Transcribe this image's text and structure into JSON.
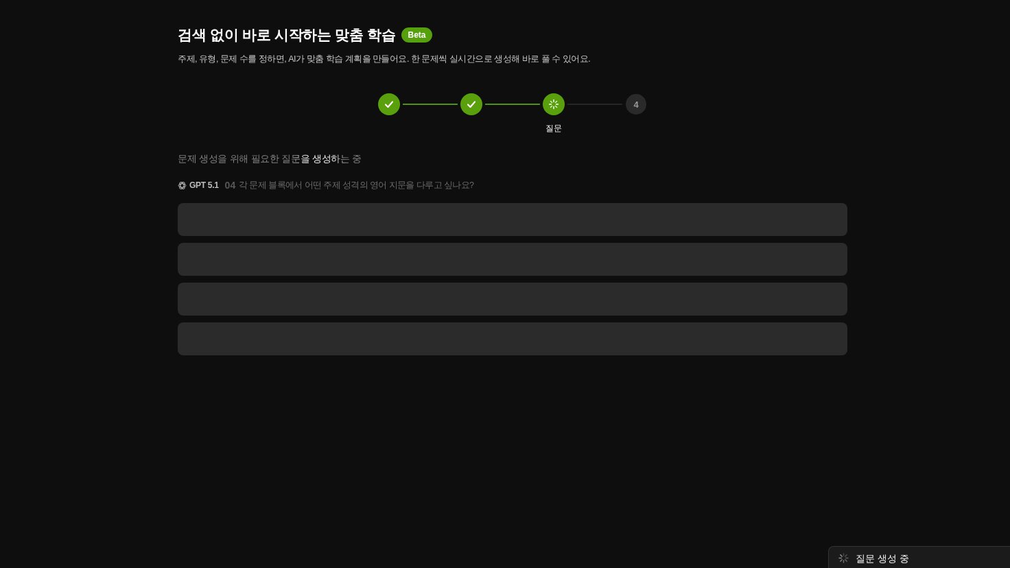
{
  "header": {
    "title": "검색 없이 바로 시작하는 맞춤 학습",
    "badge": "Beta",
    "description": "주제, 유형, 문제 수를 정하면, AI가 맞춤 학습 계획을 만들어요. 한 문제씩 실시간으로 생성해 바로 풀 수 있어요."
  },
  "stepper": {
    "steps": [
      {
        "kind": "done"
      },
      {
        "kind": "done"
      },
      {
        "kind": "active",
        "label": "질문"
      },
      {
        "kind": "pending",
        "number": "4"
      }
    ]
  },
  "progress": {
    "status_text": "문제 생성을 위해 필요한 질문을 생성하는 중",
    "model": "GPT 5.1",
    "question_number": "04",
    "question": "각 문제 블록에서 어떤 주제 성격의 영어 지문을 다루고 싶나요?"
  },
  "answer_placeholders": [
    {
      "kind": "skeleton"
    },
    {
      "kind": "skeleton"
    },
    {
      "kind": "skeleton"
    },
    {
      "kind": "skeleton"
    }
  ],
  "toast": {
    "text": "질문 생성 중"
  }
}
